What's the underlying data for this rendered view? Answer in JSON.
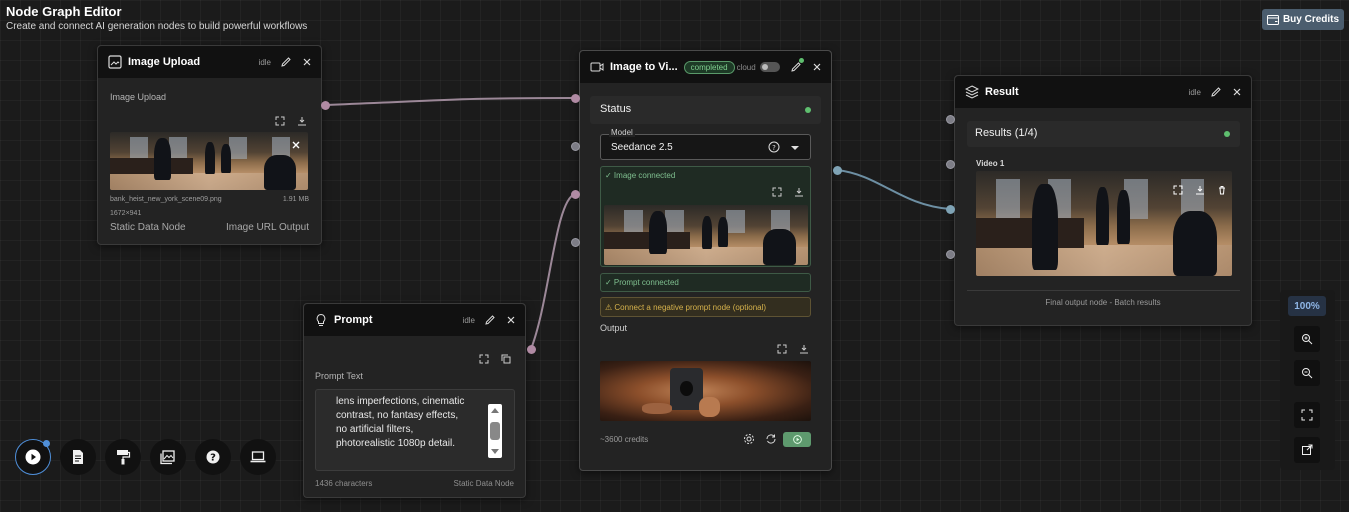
{
  "header": {
    "title": "Node Graph Editor",
    "subtitle": "Create and connect AI generation nodes to build powerful workflows",
    "buy_credits": "Buy Credits"
  },
  "image_upload_node": {
    "title": "Image Upload",
    "status": "idle",
    "section_label": "Image Upload",
    "file_name": "bank_heist_new_york_scene09.png",
    "file_size": "1.91 MB",
    "dimensions": "1672×941",
    "footer_left": "Static Data Node",
    "footer_right": "Image URL Output"
  },
  "prompt_node": {
    "title": "Prompt",
    "status": "idle",
    "section_label": "Prompt Text",
    "prompt_text_visible": "lens imperfections, cinematic contrast, no fantasy effects, no artificial filters, photorealistic 1080p detail.",
    "char_count": "1436 characters",
    "footer_right": "Static Data Node"
  },
  "image_to_video_node": {
    "title": "Image to Vi...",
    "badge": "completed",
    "cloud_label": "cloud",
    "status_label": "Status",
    "model_label": "Model",
    "model_value": "Seedance 2.5",
    "image_connected": "✓ Image connected",
    "prompt_connected": "✓ Prompt connected",
    "negative_prompt_hint": "⚠ Connect a negative prompt node (optional)",
    "output_label": "Output",
    "credits": "~3600 credits"
  },
  "result_node": {
    "title": "Result",
    "status": "idle",
    "results_label": "Results (1/4)",
    "video_label": "Video 1",
    "footer": "Final output node - Batch results"
  },
  "zoom": {
    "level": "100%"
  },
  "toolbar": [
    "play-icon",
    "document-icon",
    "paint-roller-icon",
    "gallery-icon",
    "help-icon",
    "laptop-icon"
  ],
  "colors": {
    "accent_blue": "#4f8fd9",
    "badge_green": "#6fbf7f",
    "status_dot": "#5fbf6f",
    "warning_text": "#d6b24c"
  }
}
